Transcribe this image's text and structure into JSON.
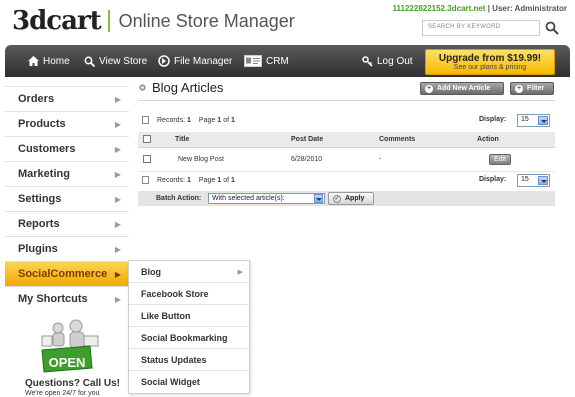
{
  "header": {
    "logo_mark": "3dcart",
    "app_title": "Online Store Manager",
    "store_domain": "111222822152.3dcart.net",
    "user_label": "| User: Administrator",
    "search_placeholder": "SEARCH BY KEYWORD"
  },
  "nav": {
    "items": [
      "Home",
      "View Store",
      "File Manager",
      "CRM",
      "Log Out"
    ],
    "upgrade_title": "Upgrade from $19.99!",
    "upgrade_sub": "See our plans & pricing"
  },
  "sidebar": {
    "items": [
      "Orders",
      "Products",
      "Customers",
      "Marketing",
      "Settings",
      "Reports",
      "Plugins",
      "SocialCommerce",
      "My Shortcuts"
    ],
    "active": "SocialCommerce",
    "help_title": "Questions? Call Us!",
    "help_sub": "We're open 24/7 for you",
    "open_badge": "OPEN"
  },
  "flyout": {
    "items": [
      "Blog",
      "Facebook Store",
      "Like Button",
      "Social Bookmarking",
      "Status Updates",
      "Social Widget"
    ]
  },
  "content": {
    "title": "Blog Articles",
    "add_button": "Add New Article",
    "filter_button": "Filter",
    "records_label": "Records:",
    "records_count": "1",
    "page_label": "Page",
    "page_current": "1",
    "page_of": "of",
    "page_total": "1",
    "display_label": "Display:",
    "display_value": "15",
    "columns": [
      "Title",
      "Post Date",
      "Comments",
      "Action"
    ],
    "rows": [
      {
        "title": "New Blog Post",
        "post_date": "6/28/2010",
        "comments": "-",
        "action": "Edit"
      }
    ],
    "batch_label": "Batch Action:",
    "batch_select": "With selected article(s):",
    "apply_label": "Apply"
  },
  "colors": {
    "accent_green": "#7bc043",
    "nav_dark": "#3a3a3a",
    "upgrade_yellow": "#f5b800"
  }
}
